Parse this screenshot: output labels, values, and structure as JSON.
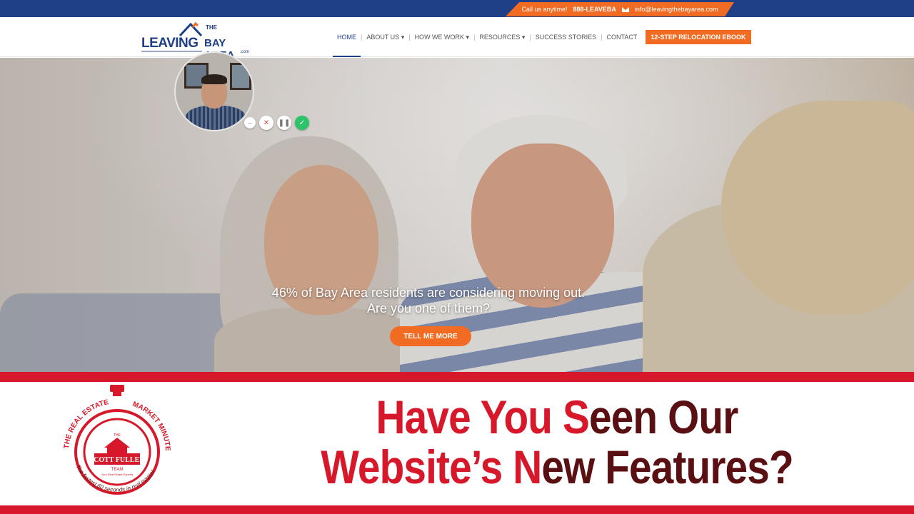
{
  "topbar": {
    "call_text": "Call us anytime!",
    "phone": "888-LEAVEBA",
    "email": "info@leavingthebayarea.com",
    "mail_icon": "mail-icon"
  },
  "logo": {
    "leaving": "LEAVING",
    "the": "THE",
    "bay_area": "BAY AREA",
    "com": ".com"
  },
  "nav": {
    "items": [
      {
        "label": "HOME"
      },
      {
        "label": "ABOUT US ▾"
      },
      {
        "label": "HOW WE WORK ▾"
      },
      {
        "label": "RESOURCES ▾"
      },
      {
        "label": "SUCCESS STORIES"
      },
      {
        "label": "CONTACT"
      }
    ],
    "ebook_label": "12-STEP RELOCATION EBOOK"
  },
  "hero": {
    "line1": "46% of Bay Area residents are considering moving out.",
    "line2": "Are you one of them?",
    "cta": "TELL ME MORE"
  },
  "webcam_controls": {
    "minimize": "–",
    "close": "✕",
    "pause": "❚❚",
    "confirm": "✓"
  },
  "title": {
    "line1_a": "Have You ",
    "line1_b": "S",
    "line1_c": "een Our",
    "line2_a": "Website’s ",
    "line2_b": "N",
    "line2_c": "ew Features?"
  },
  "badge": {
    "arc_left": "THE REAL ESTATE",
    "arc_right": "MARKET MINUTE",
    "brand_the": "THE",
    "brand_name": "SCOTT FULLER",
    "brand_team": "TEAM",
    "brand_tag": "Your Real Estate Experts",
    "arc_bottom": "The fastest 60 seconds in real estate!"
  },
  "colors": {
    "brand_blue": "#1f3f86",
    "accent_orange": "#f26b22",
    "band_red": "#d7182a",
    "title_dark": "#5a0f12"
  }
}
